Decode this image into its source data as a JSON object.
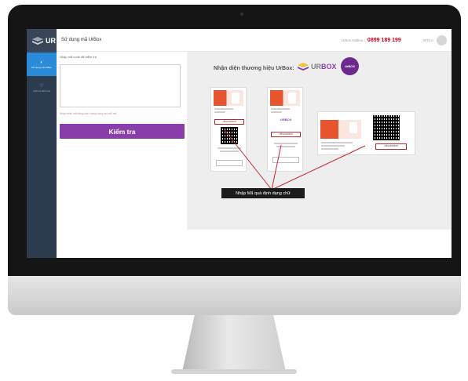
{
  "sidebar": {
    "logo_text": "UR",
    "items": [
      {
        "label": "Sử dụng mã UrBox",
        "icon": "circle-icon",
        "active": true
      },
      {
        "label": "Lịch sử kiểm tra",
        "icon": "history-icon",
        "active": false
      }
    ]
  },
  "header": {
    "title": "Sử dụng mã UrBox",
    "hotline_label": "Urbox Hotline :",
    "hotline_number": "0899 189 199",
    "user_name": "WTCA"
  },
  "form": {
    "input_label": "Nhập mã code để kiểm tra",
    "input_value": "",
    "hint": "Nhập nhiều mã bằng cách xuống dòng sau mỗi mã",
    "button_label": "Kiểm tra"
  },
  "brand": {
    "title": "Nhận diện thương hiệu UrBox:",
    "logo_text_a": "UR",
    "logo_text_b": "BOX",
    "circle_text": "UrBOX"
  },
  "vouchers": {
    "card1_code": "UB12345678",
    "card2_code": "UB12345678",
    "card2_logo": "URBOX",
    "card3_code": "UB12345678"
  },
  "callout": {
    "text": "Nhập Mã quà định dạng chữ"
  },
  "colors": {
    "primary_button": "#8a3ea9",
    "hotline": "#d0021b",
    "sidebar_bg": "#2d3b4f",
    "sidebar_active": "#2a8bd8",
    "highlight_box": "#c0272d"
  }
}
